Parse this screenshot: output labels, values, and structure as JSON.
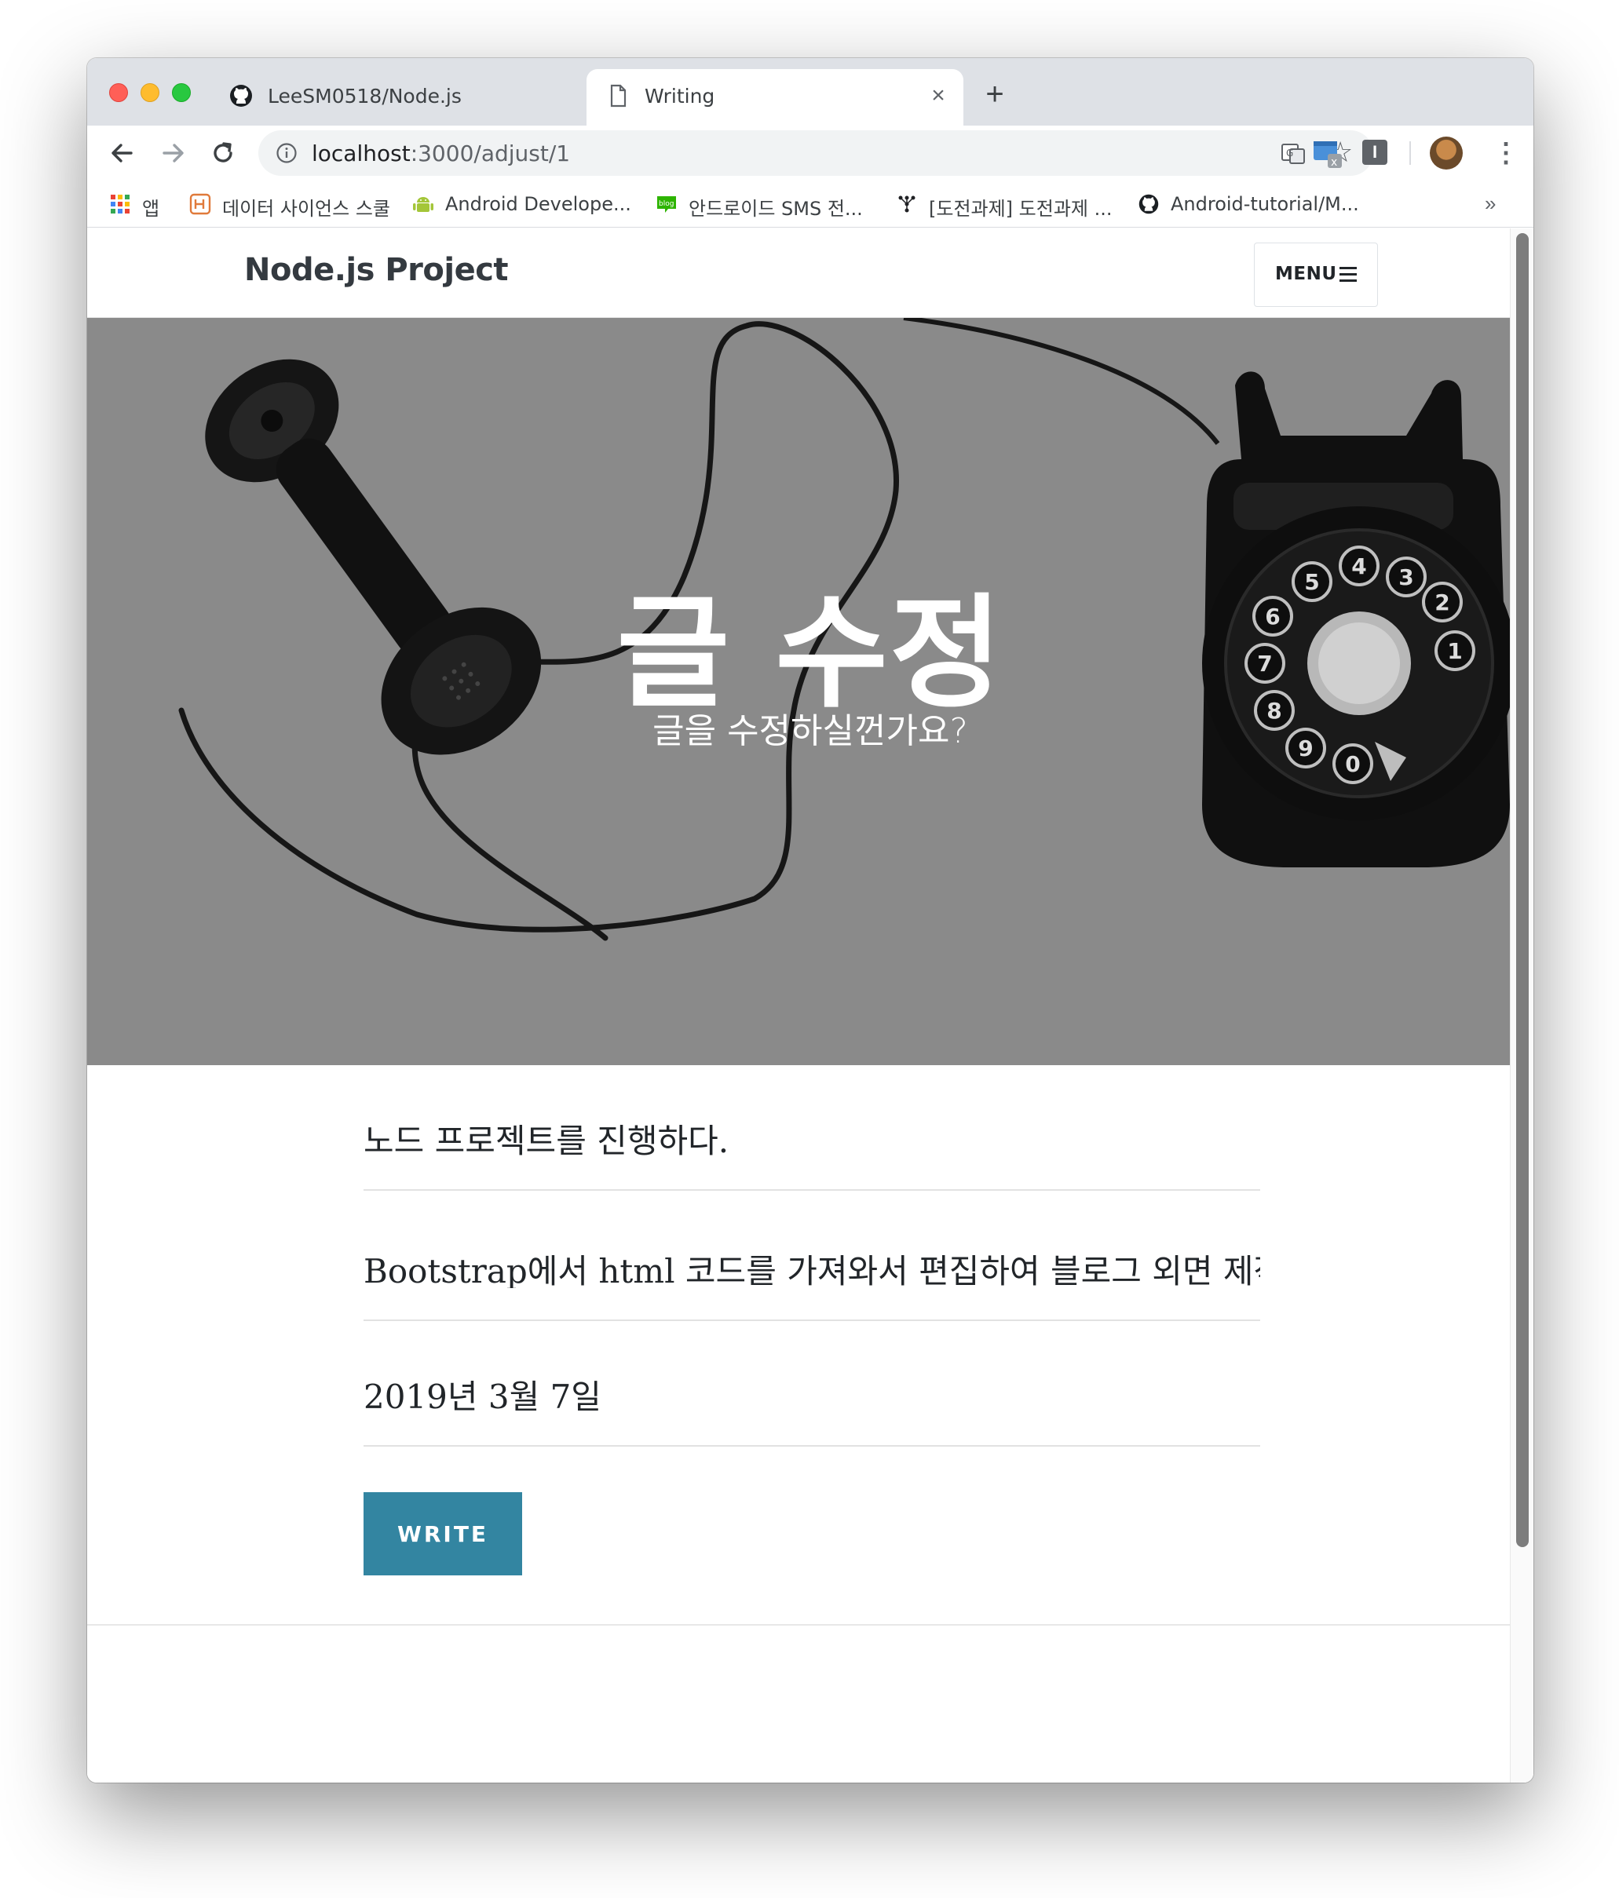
{
  "browser": {
    "tabs": [
      {
        "title": "LeeSM0518/Node.js",
        "icon": "github-icon"
      },
      {
        "title": "Writing",
        "icon": "document-icon"
      }
    ],
    "tab_close": "×",
    "new_tab": "+",
    "url_host": "localhost",
    "url_rest": ":3000/adjust/1",
    "menu_dots": "⋮",
    "bookmarks": [
      {
        "label": "앱",
        "icon": "apps-grid-icon"
      },
      {
        "label": "데이터 사이언스 스쿨",
        "icon": "datascience-icon"
      },
      {
        "label": "Android Develope...",
        "icon": "android-icon"
      },
      {
        "label": "안드로이드 SMS 전...",
        "icon": "blog-icon"
      },
      {
        "label": "[도전과제] 도전과제 ...",
        "icon": "tree-icon"
      },
      {
        "label": "Android-tutorial/M...",
        "icon": "github-icon"
      }
    ],
    "bookmarks_more": "»",
    "colors": {
      "tabbar": "#dee1e6",
      "omnibox": "#f1f3f4"
    }
  },
  "site": {
    "brand": "Node.js Project",
    "menu_label": "MENU",
    "hero_title": "글 수정",
    "hero_subtitle": "글을 수정하실껀가요?",
    "fields": {
      "title": "노드 프로젝트를 진행하다.",
      "body": "Bootstrap에서 html 코드를 가져와서 편집하여 블로그 외면 제작",
      "date": "2019년 3월 7일"
    },
    "write_button": "WRITE",
    "colors": {
      "accent": "#3385a1",
      "hero_bg": "#8a8a8a"
    }
  }
}
